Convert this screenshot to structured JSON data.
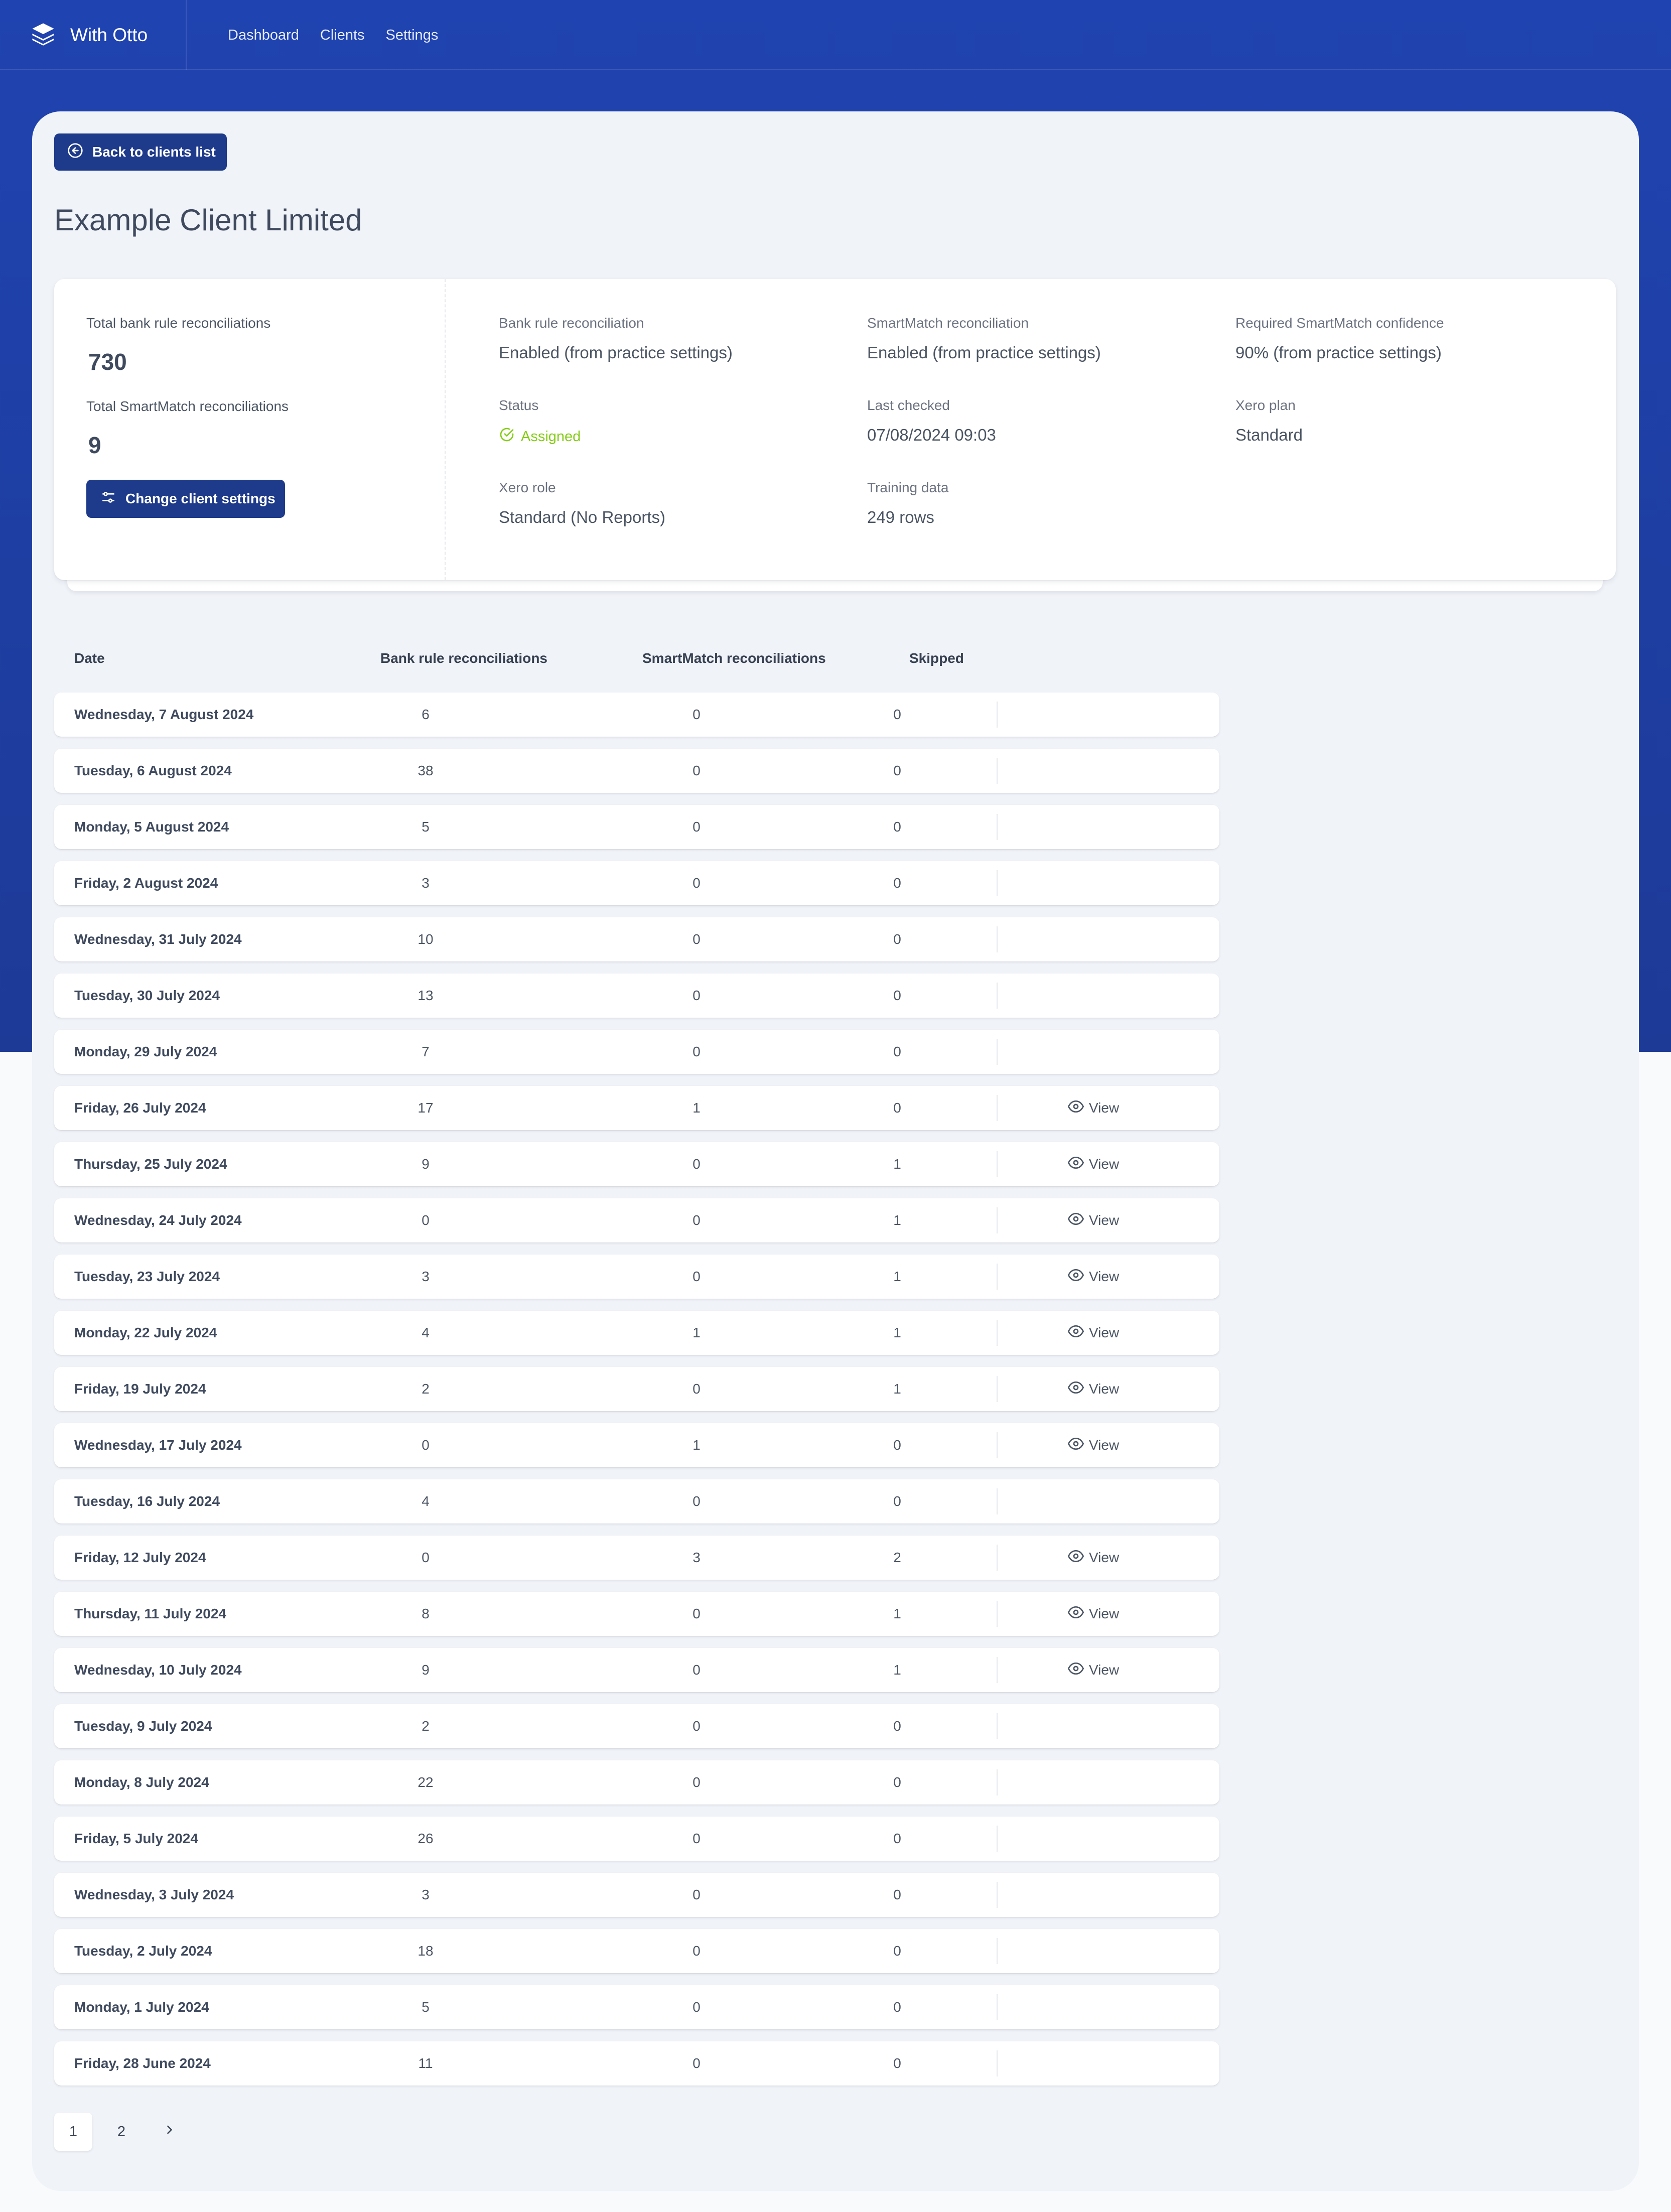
{
  "app": {
    "name": "With Otto",
    "nav": [
      {
        "label": "Dashboard"
      },
      {
        "label": "Clients"
      },
      {
        "label": "Settings"
      }
    ]
  },
  "colors": {
    "brand": "#1f43b0",
    "button": "#1e3a8a",
    "status_assigned": "#84cc16"
  },
  "page": {
    "back_label": "Back to clients list",
    "title": "Example Client Limited",
    "settings_button": "Change client settings"
  },
  "stats": {
    "total_bank_label": "Total bank rule reconciliations",
    "total_bank_value": "730",
    "total_smartmatch_label": "Total SmartMatch reconciliations",
    "total_smartmatch_value": "9"
  },
  "info": {
    "bank_rule": {
      "label": "Bank rule reconciliation",
      "value": "Enabled (from practice settings)"
    },
    "smartmatch": {
      "label": "SmartMatch reconciliation",
      "value": "Enabled (from practice settings)"
    },
    "confidence": {
      "label": "Required SmartMatch confidence",
      "value": "90% (from practice settings)"
    },
    "status": {
      "label": "Status",
      "value": "Assigned"
    },
    "last_checked": {
      "label": "Last checked",
      "value": "07/08/2024 09:03"
    },
    "xero_plan": {
      "label": "Xero plan",
      "value": "Standard"
    },
    "xero_role": {
      "label": "Xero role",
      "value": "Standard (No Reports)"
    },
    "training": {
      "label": "Training data",
      "value": "249 rows"
    }
  },
  "table": {
    "headers": {
      "date": "Date",
      "bank": "Bank rule reconciliations",
      "smartmatch": "SmartMatch reconciliations",
      "skipped": "Skipped"
    },
    "view_label": "View",
    "rows": [
      {
        "date": "Wednesday, 7 August 2024",
        "bank": "6",
        "smartmatch": "0",
        "skipped": "0",
        "view": false
      },
      {
        "date": "Tuesday, 6 August 2024",
        "bank": "38",
        "smartmatch": "0",
        "skipped": "0",
        "view": false
      },
      {
        "date": "Monday, 5 August 2024",
        "bank": "5",
        "smartmatch": "0",
        "skipped": "0",
        "view": false
      },
      {
        "date": "Friday, 2 August 2024",
        "bank": "3",
        "smartmatch": "0",
        "skipped": "0",
        "view": false
      },
      {
        "date": "Wednesday, 31 July 2024",
        "bank": "10",
        "smartmatch": "0",
        "skipped": "0",
        "view": false
      },
      {
        "date": "Tuesday, 30 July 2024",
        "bank": "13",
        "smartmatch": "0",
        "skipped": "0",
        "view": false
      },
      {
        "date": "Monday, 29 July 2024",
        "bank": "7",
        "smartmatch": "0",
        "skipped": "0",
        "view": false
      },
      {
        "date": "Friday, 26 July 2024",
        "bank": "17",
        "smartmatch": "1",
        "skipped": "0",
        "view": true
      },
      {
        "date": "Thursday, 25 July 2024",
        "bank": "9",
        "smartmatch": "0",
        "skipped": "1",
        "view": true
      },
      {
        "date": "Wednesday, 24 July 2024",
        "bank": "0",
        "smartmatch": "0",
        "skipped": "1",
        "view": true
      },
      {
        "date": "Tuesday, 23 July 2024",
        "bank": "3",
        "smartmatch": "0",
        "skipped": "1",
        "view": true
      },
      {
        "date": "Monday, 22 July 2024",
        "bank": "4",
        "smartmatch": "1",
        "skipped": "1",
        "view": true
      },
      {
        "date": "Friday, 19 July 2024",
        "bank": "2",
        "smartmatch": "0",
        "skipped": "1",
        "view": true
      },
      {
        "date": "Wednesday, 17 July 2024",
        "bank": "0",
        "smartmatch": "1",
        "skipped": "0",
        "view": true
      },
      {
        "date": "Tuesday, 16 July 2024",
        "bank": "4",
        "smartmatch": "0",
        "skipped": "0",
        "view": false
      },
      {
        "date": "Friday, 12 July 2024",
        "bank": "0",
        "smartmatch": "3",
        "skipped": "2",
        "view": true
      },
      {
        "date": "Thursday, 11 July 2024",
        "bank": "8",
        "smartmatch": "0",
        "skipped": "1",
        "view": true
      },
      {
        "date": "Wednesday, 10 July 2024",
        "bank": "9",
        "smartmatch": "0",
        "skipped": "1",
        "view": true
      },
      {
        "date": "Tuesday, 9 July 2024",
        "bank": "2",
        "smartmatch": "0",
        "skipped": "0",
        "view": false
      },
      {
        "date": "Monday, 8 July 2024",
        "bank": "22",
        "smartmatch": "0",
        "skipped": "0",
        "view": false
      },
      {
        "date": "Friday, 5 July 2024",
        "bank": "26",
        "smartmatch": "0",
        "skipped": "0",
        "view": false
      },
      {
        "date": "Wednesday, 3 July 2024",
        "bank": "3",
        "smartmatch": "0",
        "skipped": "0",
        "view": false
      },
      {
        "date": "Tuesday, 2 July 2024",
        "bank": "18",
        "smartmatch": "0",
        "skipped": "0",
        "view": false
      },
      {
        "date": "Monday, 1 July 2024",
        "bank": "5",
        "smartmatch": "0",
        "skipped": "0",
        "view": false
      },
      {
        "date": "Friday, 28 June 2024",
        "bank": "11",
        "smartmatch": "0",
        "skipped": "0",
        "view": false
      }
    ]
  },
  "pagination": {
    "pages": [
      "1",
      "2"
    ],
    "current": "1",
    "next_icon": "chevron-right-icon"
  }
}
